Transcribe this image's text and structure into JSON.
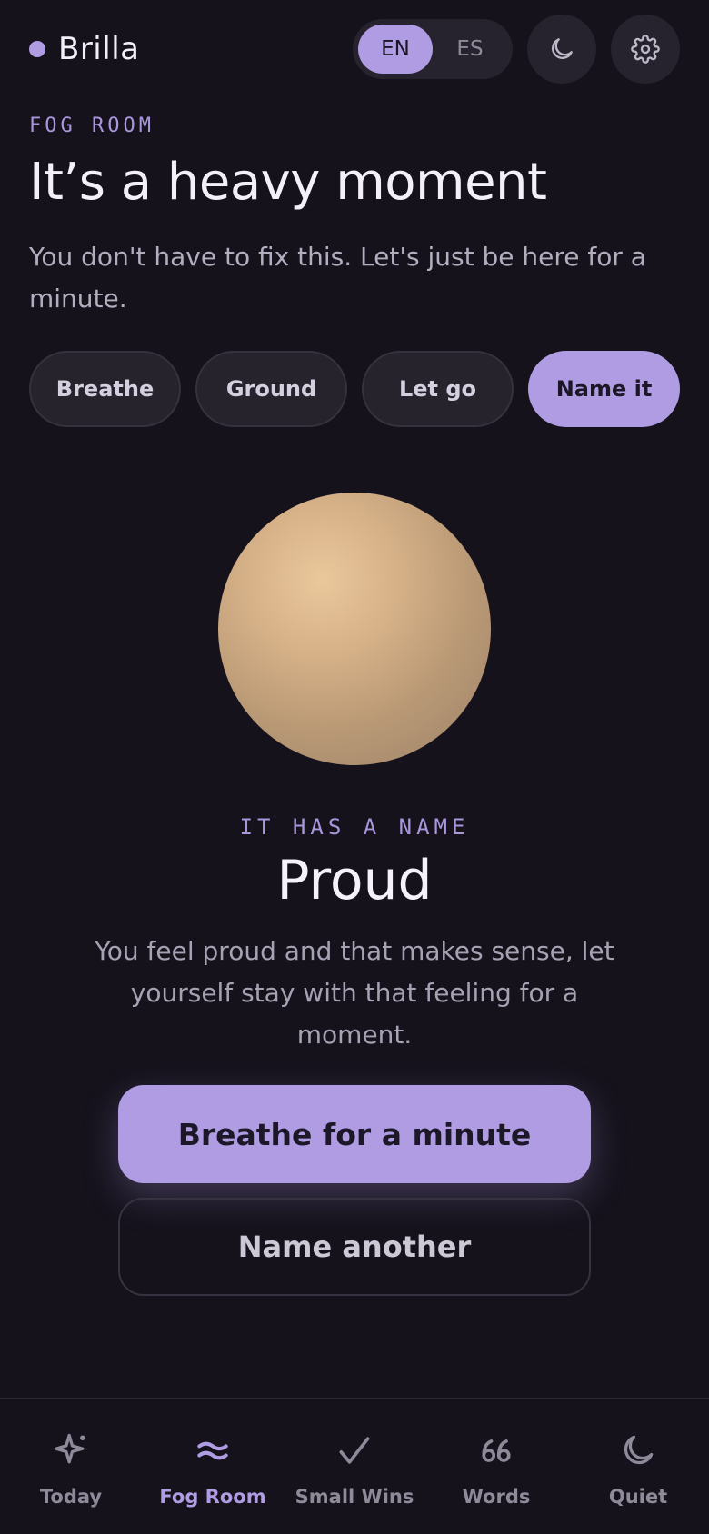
{
  "app": {
    "name": "Brilla"
  },
  "header": {
    "languages": [
      {
        "code": "EN",
        "active": true
      },
      {
        "code": "ES",
        "active": false
      }
    ],
    "theme_icon": "moon-icon",
    "settings_icon": "gear-icon"
  },
  "intro": {
    "eyebrow": "FOG ROOM",
    "title": "It’s a heavy moment",
    "subtitle": "You don't have to fix this. Let's just be here for a minute."
  },
  "tabs": [
    {
      "label": "Breathe",
      "active": false
    },
    {
      "label": "Ground",
      "active": false
    },
    {
      "label": "Let go",
      "active": false
    },
    {
      "label": "Name it",
      "active": true
    }
  ],
  "feeling": {
    "eyebrow": "IT HAS A NAME",
    "name": "Proud",
    "description": "You feel proud and that makes sense, let yourself stay with that feeling for a moment."
  },
  "actions": {
    "primary_label": "Breathe for a minute",
    "secondary_label": "Name another"
  },
  "colors": {
    "accent": "#b09ce3",
    "background": "#15121c",
    "surface": "#26232e",
    "orb": "#d6b188"
  },
  "nav": [
    {
      "label": "Today",
      "icon": "sparkle-icon",
      "active": false
    },
    {
      "label": "Fog Room",
      "icon": "waves-icon",
      "active": true
    },
    {
      "label": "Small Wins",
      "icon": "check-icon",
      "active": false
    },
    {
      "label": "Words",
      "icon": "quote-icon",
      "active": false
    },
    {
      "label": "Quiet",
      "icon": "moon-icon",
      "active": false
    }
  ]
}
